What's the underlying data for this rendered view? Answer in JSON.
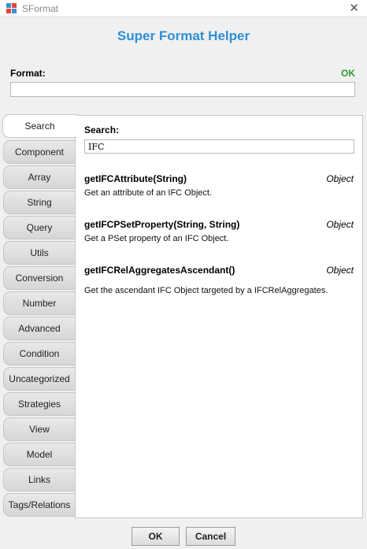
{
  "window": {
    "title": "SFormat"
  },
  "header": {
    "title": "Super Format Helper"
  },
  "format": {
    "label": "Format:",
    "status": "OK",
    "value": ""
  },
  "tabs": [
    "Search",
    "Component",
    "Array",
    "String",
    "Query",
    "Utils",
    "Conversion",
    "Number",
    "Advanced",
    "Condition",
    "Uncategorized",
    "Strategies",
    "View",
    "Model",
    "Links",
    "Tags/Relations"
  ],
  "active_tab": "Search",
  "search": {
    "label": "Search:",
    "value": "IFC"
  },
  "results": [
    {
      "name": "getIFCAttribute(String)",
      "type": "Object",
      "desc": "Get an attribute of an IFC Object."
    },
    {
      "name": "getIFCPSetProperty(String, String)",
      "type": "Object",
      "desc": "Get a PSet property of an IFC Object."
    },
    {
      "name": "getIFCRelAggregatesAscendant()",
      "type": "Object",
      "desc": "Get the ascendant IFC Object targeted by a IFCRelAggregates."
    }
  ],
  "buttons": {
    "ok": "OK",
    "cancel": "Cancel"
  },
  "colors": {
    "header": "#2e8fd9",
    "status_ok": "#2e9a2e"
  }
}
